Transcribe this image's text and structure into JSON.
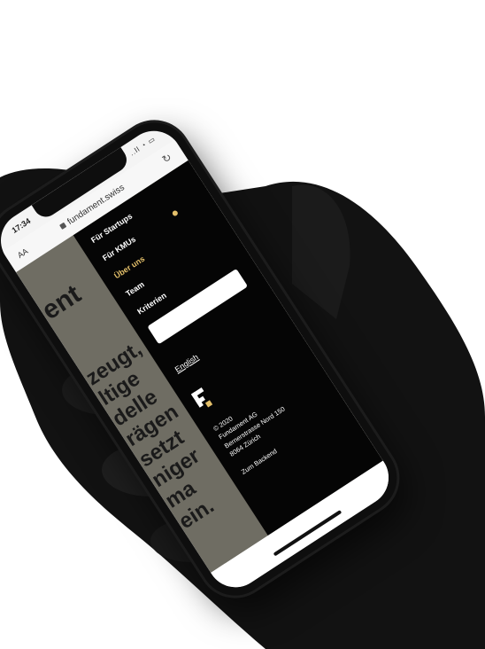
{
  "status_bar": {
    "time": "17:34",
    "icons": "..ll ◔ ▭"
  },
  "browser": {
    "text_size_label": "AA",
    "url": "fundament.swiss"
  },
  "background_page": {
    "heading_fragment": "ent",
    "body_lines": [
      "zeugt,",
      "ltige",
      "delle",
      "rägen",
      "setzt",
      "niger",
      "ma",
      "ein."
    ]
  },
  "menu": {
    "items": [
      {
        "label": "Für Startups",
        "active": false
      },
      {
        "label": "Für KMUs",
        "active": false
      },
      {
        "label": "Über uns",
        "active": true
      },
      {
        "label": "Team",
        "active": false
      },
      {
        "label": "Kriterien",
        "active": false
      }
    ],
    "language_link": "English",
    "footer": {
      "copyright": "© 2020",
      "company": "Fundament AG",
      "street": "Bernerstrasse Nord 150",
      "city": "8064 Zürich"
    },
    "backend_link": "Zum Backend"
  },
  "colors": {
    "accent": "#e4c06a",
    "menu_bg": "#050505",
    "page_bg": "#6f6d63"
  }
}
